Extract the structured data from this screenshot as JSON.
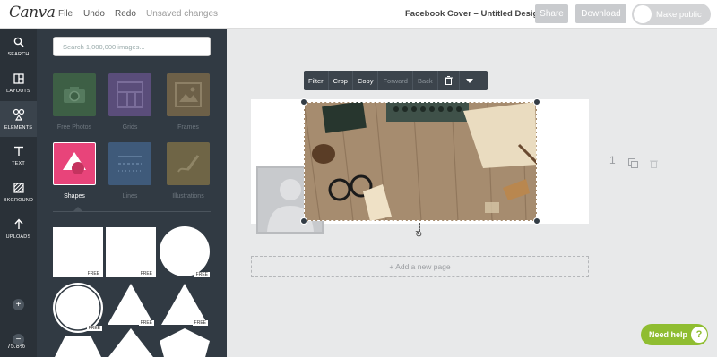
{
  "app": {
    "logo": "Canva"
  },
  "menu": {
    "file": "File",
    "undo": "Undo",
    "redo": "Redo",
    "status": "Unsaved changes"
  },
  "document": {
    "title": "Facebook Cover – Untitled Design"
  },
  "actions": {
    "share": "Share",
    "download": "Download",
    "make_public": "Make public"
  },
  "rail": {
    "items": [
      {
        "label": "SEARCH",
        "icon": "search-icon"
      },
      {
        "label": "LAYOUTS",
        "icon": "layouts-icon"
      },
      {
        "label": "ELEMENTS",
        "icon": "elements-icon"
      },
      {
        "label": "TEXT",
        "icon": "text-icon"
      },
      {
        "label": "BKGROUND",
        "icon": "background-icon"
      },
      {
        "label": "UPLOADS",
        "icon": "uploads-icon"
      }
    ],
    "zoom_in": "+",
    "zoom_out": "−",
    "zoom_level": "75.8%"
  },
  "panel": {
    "search_placeholder": "Search 1,000,000 images...",
    "categories": [
      {
        "label": "Free Photos",
        "color": "#3d5f45"
      },
      {
        "label": "Grids",
        "color": "#5a4d7a"
      },
      {
        "label": "Frames",
        "color": "#6d6048"
      },
      {
        "label": "Shapes",
        "color": "#e8447a"
      },
      {
        "label": "Lines",
        "color": "#3f5a7a"
      },
      {
        "label": "Illustrations",
        "color": "#6f6546"
      }
    ],
    "free_badge": "FREE"
  },
  "toolbar": {
    "filter": "Filter",
    "crop": "Crop",
    "copy": "Copy",
    "forward": "Forward",
    "back": "Back"
  },
  "canvas": {
    "add_page": "+ Add a new page",
    "page_number": "1"
  },
  "help": {
    "label": "Need help",
    "icon": "?"
  }
}
